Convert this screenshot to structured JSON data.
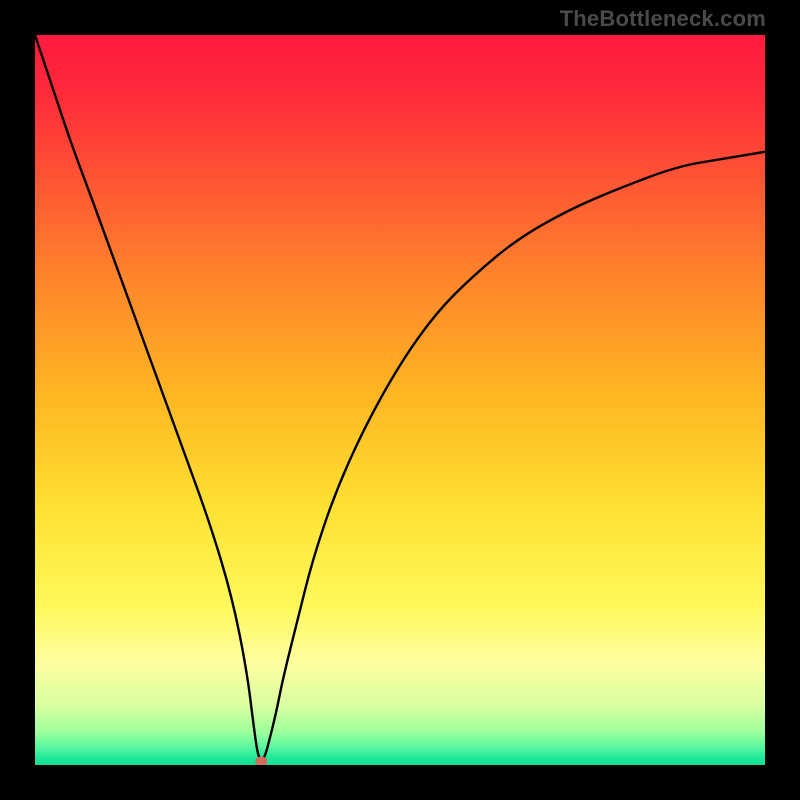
{
  "watermark": "TheBottleneck.com",
  "chart_data": {
    "type": "line",
    "title": "",
    "xlabel": "",
    "ylabel": "",
    "xlim": [
      0,
      100
    ],
    "ylim": [
      0,
      100
    ],
    "legend": false,
    "grid": false,
    "background_gradient_stops": [
      {
        "offset": 0.0,
        "color": "#ff1a3d"
      },
      {
        "offset": 0.08,
        "color": "#ff2a3b"
      },
      {
        "offset": 0.2,
        "color": "#ff5533"
      },
      {
        "offset": 0.35,
        "color": "#ff8a2a"
      },
      {
        "offset": 0.5,
        "color": "#ffb822"
      },
      {
        "offset": 0.65,
        "color": "#ffe233"
      },
      {
        "offset": 0.78,
        "color": "#fff85a"
      },
      {
        "offset": 0.86,
        "color": "#ffffa0"
      },
      {
        "offset": 0.92,
        "color": "#d7ffa0"
      },
      {
        "offset": 0.955,
        "color": "#9cff9c"
      },
      {
        "offset": 0.975,
        "color": "#5cf7a0"
      },
      {
        "offset": 0.99,
        "color": "#20e89a"
      },
      {
        "offset": 1.0,
        "color": "#14dd92"
      }
    ],
    "series": [
      {
        "name": "bottleneck-curve",
        "color": "#000000",
        "stroke_width": 2.4,
        "x": [
          0,
          2,
          5,
          8,
          12,
          16,
          20,
          24,
          27,
          29,
          30,
          30.5,
          31,
          31.5,
          32,
          33,
          34,
          36,
          38,
          41,
          45,
          50,
          55,
          60,
          66,
          73,
          80,
          88,
          94,
          100
        ],
        "y": [
          100,
          94,
          85,
          77,
          66,
          55,
          44,
          33,
          23,
          13,
          5,
          1.5,
          0.5,
          1.2,
          3,
          7,
          12,
          20,
          28,
          37,
          46,
          55,
          62,
          67,
          72,
          76,
          79,
          82,
          83,
          84
        ]
      }
    ],
    "marker": {
      "name": "optimum-point",
      "x": 31,
      "y": 0.5,
      "rx": 6,
      "ry": 5,
      "color": "#d46a5e"
    }
  }
}
